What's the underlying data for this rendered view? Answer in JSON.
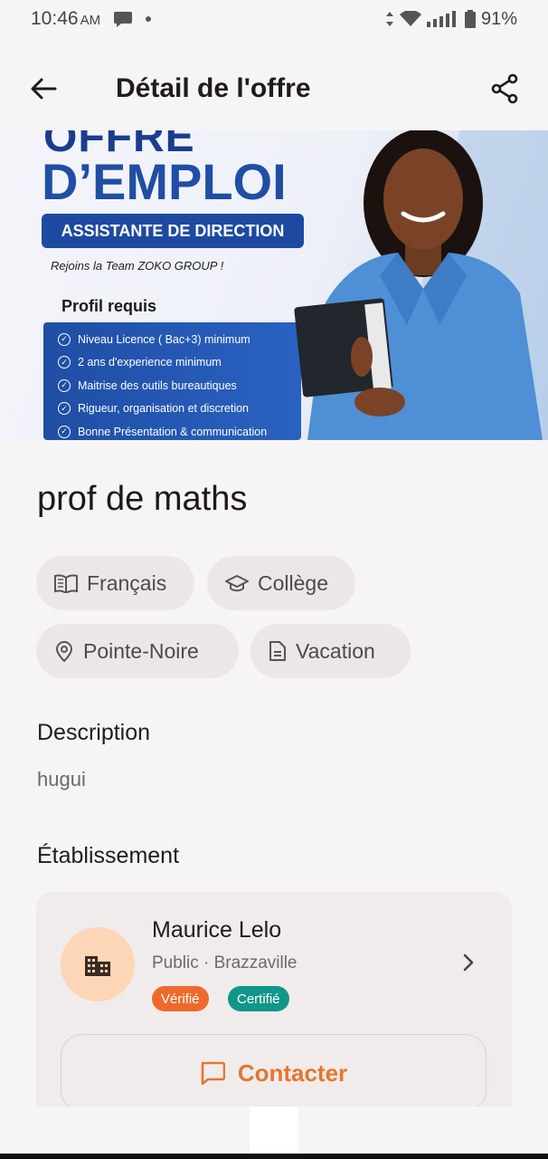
{
  "status_bar": {
    "time": "10:46",
    "ampm": "AM",
    "battery": "91%"
  },
  "app_bar": {
    "title": "Détail de l'offre"
  },
  "banner": {
    "heading_top": "OFFRE",
    "heading_main": "D’EMPLOI",
    "position": "ASSISTANTE DE DIRECTION",
    "join": "Rejoins la Team ZOKO GROUP !",
    "profile_title": "Profil requis",
    "requirements": [
      "Niveau Licence ( Bac+3) minimum",
      "2 ans d'experience minimum",
      "Maitrise des outils bureautiques",
      "Rigueur, organisation et discretion",
      "Bonne Présentation & communication"
    ]
  },
  "job": {
    "title": "prof de maths",
    "chips": [
      {
        "label": "Français",
        "icon": "book-icon"
      },
      {
        "label": "Collège",
        "icon": "graduation-cap-icon"
      },
      {
        "label": "Pointe-Noire",
        "icon": "location-pin-icon"
      },
      {
        "label": "Vacation",
        "icon": "document-icon"
      }
    ]
  },
  "description": {
    "label": "Description",
    "text": "hugui"
  },
  "establishment": {
    "label": "Établissement",
    "name": "Maurice Lelo",
    "meta": "Public · Brazzaville",
    "badges": [
      {
        "label": "Vérifié",
        "color": "#ee6a2c"
      },
      {
        "label": "Certifié",
        "color": "#13968a"
      }
    ],
    "contact_label": "Contacter"
  },
  "colors": {
    "accent": "#e5762f",
    "background": "#f6f4f4",
    "chip_bg": "#ece7e6",
    "banner_blue": "#1f4ea4"
  }
}
